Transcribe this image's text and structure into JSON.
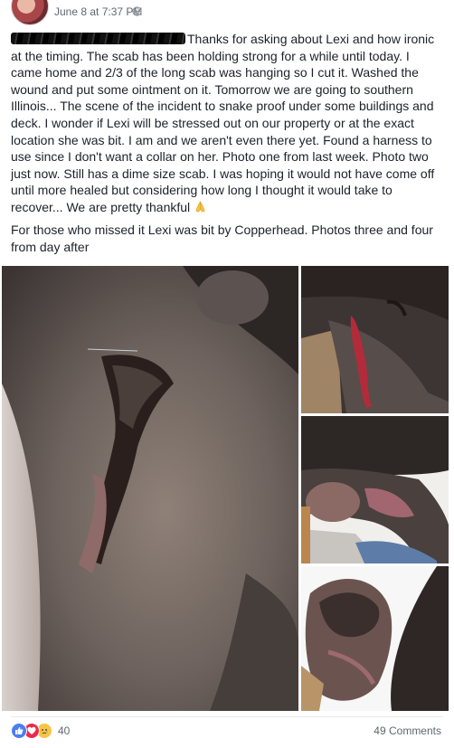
{
  "post": {
    "timestamp": "June 8 at 7:37 PM",
    "text_1": "Thanks for asking about Lexi and how ironic at the timing. The scab has been holding strong for a while until today. I came home and 2/3 of the long scab was hanging so I cut it. Washed the wound and put some ointment on it. Tomorrow we are going to southern Illinois... The scene of the incident to snake proof under some buildings and deck. I wonder if Lexi will be stressed out on our property or at the exact location she was bit. I am and we aren't even there yet. Found a harness to use since I don't want a collar on her. Photo one from last week. Photo two just now. Still has a dime size scab. I was hoping it would not have come off until more healed but considering how long I thought it would take to recover... We are pretty thankful",
    "text_2": "For those who missed it Lexi was bit by Copperhead. Photos three and four from day after"
  },
  "footer": {
    "reaction_count": "40",
    "comments": "49 Comments"
  },
  "colors": {
    "link_blue": "#4267b2",
    "like_blue": "#4a7ef2",
    "love_red": "#f0284a",
    "sad_yellow": "#f7c445"
  }
}
